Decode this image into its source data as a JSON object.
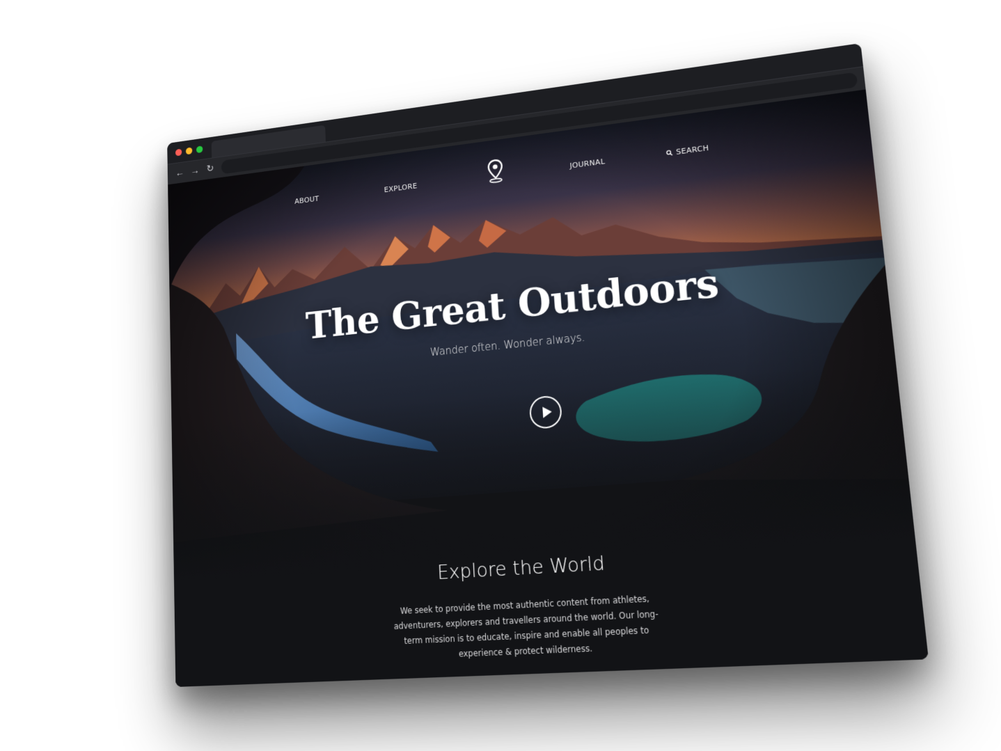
{
  "browser": {
    "window_controls": [
      "close",
      "minimize",
      "maximize"
    ],
    "nav_icons": [
      "back-arrow-icon",
      "forward-arrow-icon",
      "reload-icon"
    ]
  },
  "site": {
    "nav": {
      "about": "ABOUT",
      "explore": "EXPLORE",
      "journal": "JOURNAL",
      "search": "SEARCH",
      "logo_icon": "map-pin-icon",
      "search_icon": "search-icon"
    },
    "hero": {
      "title": "The Great Outdoors",
      "subtitle": "Wander often. Wonder always.",
      "play_icon": "play-icon"
    },
    "section": {
      "title": "Explore the World",
      "body": "We seek to provide the most authentic content from athletes, adventurers, explorers and travellers around the world. Our long-term mission is to educate, inspire and enable all peoples to experience & protect wilderness."
    }
  },
  "colors": {
    "chrome_dark": "#1d1e22",
    "page_bg": "#121316",
    "text": "#ffffff",
    "sky_glow": "#c96a3a",
    "glacier": "#5a8fc8",
    "lake": "#1f6a6a"
  }
}
